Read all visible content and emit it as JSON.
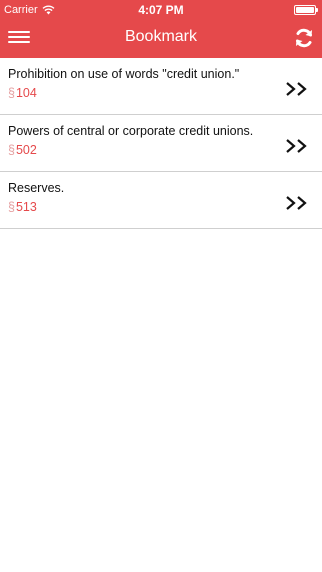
{
  "status_bar": {
    "carrier": "Carrier",
    "time": "4:07 PM",
    "battery_level": 1.0
  },
  "nav": {
    "title": "Bookmark",
    "menu_icon": "hamburger-menu-icon",
    "refresh_icon": "refresh-icon"
  },
  "colors": {
    "accent": "#e5494b",
    "section_symbol": "#e5a1a2",
    "divider": "#cfcfcf"
  },
  "bookmarks": [
    {
      "title": "Prohibition on use of words \"credit union.\"",
      "symbol": "§",
      "section": "104"
    },
    {
      "title": "Powers of central or corporate credit unions.",
      "symbol": "§",
      "section": "502"
    },
    {
      "title": "Reserves.",
      "symbol": "§",
      "section": "513"
    }
  ]
}
